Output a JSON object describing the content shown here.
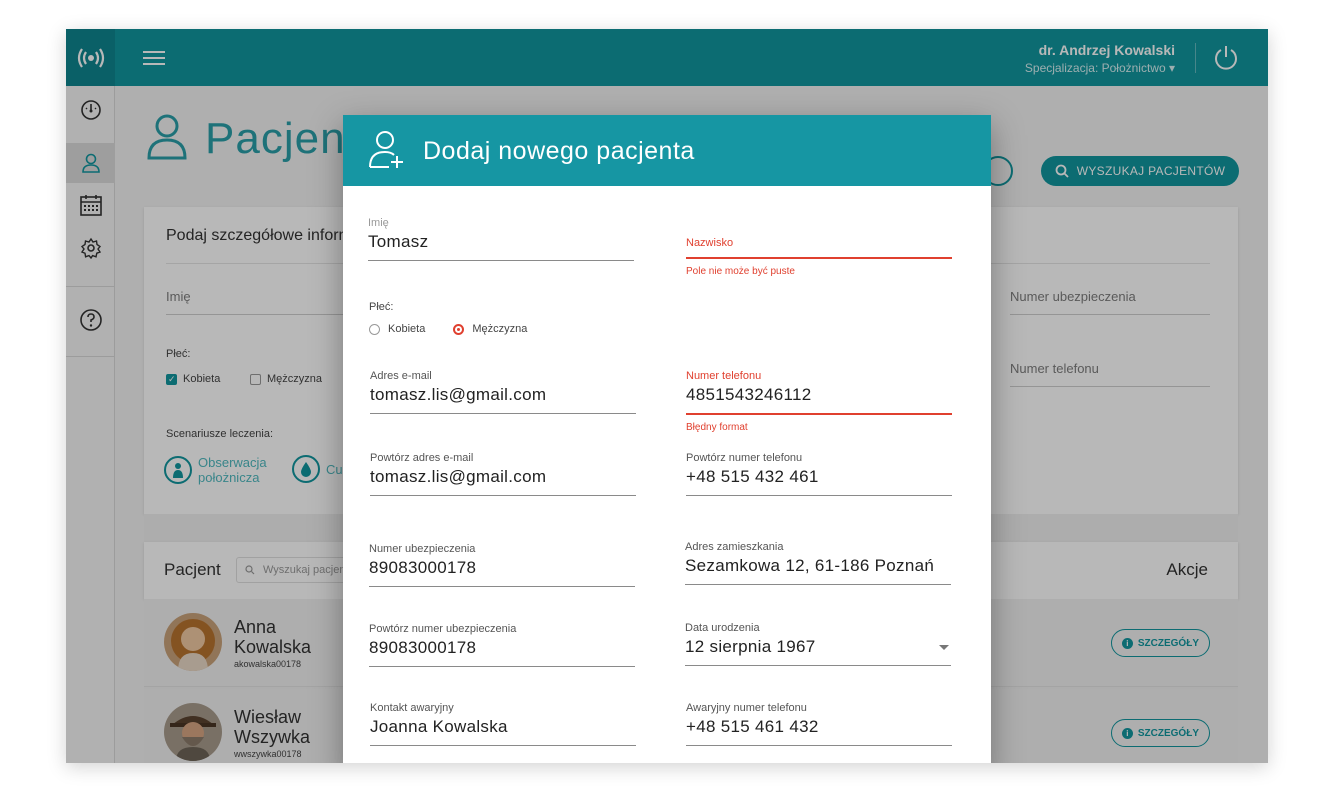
{
  "topbar": {
    "user_name": "dr. Andrzej Kowalski",
    "user_spec": "Specjalizacja: Położnictwo ▾"
  },
  "sidebar": {
    "items": [
      {
        "name": "dashboard-icon"
      },
      {
        "name": "user-icon"
      },
      {
        "name": "calendar-icon"
      },
      {
        "name": "gear-icon"
      },
      {
        "name": "help-icon"
      }
    ]
  },
  "page": {
    "title": "Pacjenci",
    "search_button": "WYSZUKAJ PACJENTÓW",
    "filters": {
      "title": "Podaj szczegółowe informacje",
      "first_name_placeholder": "Imię",
      "insurance_placeholder": "Numer ubezpieczenia",
      "phone_placeholder": "Numer telefonu",
      "gender_label": "Płeć:",
      "gender_female": "Kobieta",
      "gender_male": "Mężczyzna",
      "scenarios_label": "Scenariusze leczenia:",
      "scenario_1": "Obserwacja położnicza",
      "scenario_2": "Cu"
    },
    "list": {
      "col_patient": "Pacjent",
      "search_placeholder": "Wyszukaj pacjenta",
      "col_actions": "Akcje",
      "details_label": "SZCZEGÓŁY",
      "rows": [
        {
          "first": "Anna",
          "last": "Kowalska",
          "user": "akowalska00178"
        },
        {
          "first": "Wiesław",
          "last": "Wszywka",
          "user": "wwszywka00178"
        }
      ]
    }
  },
  "modal": {
    "title": "Dodaj nowego pacjenta",
    "first_name": {
      "label": "Imię",
      "value": "Tomasz"
    },
    "last_name": {
      "label": "Nazwisko",
      "value": "",
      "error": "Pole nie może być puste"
    },
    "gender": {
      "label": "Płeć:",
      "female": "Kobieta",
      "male": "Mężczyzna",
      "selected": "male"
    },
    "email": {
      "label": "Adres e-mail",
      "value": "tomasz.lis@gmail.com"
    },
    "phone": {
      "label": "Numer telefonu",
      "value": "4851543246112",
      "error": "Błędny format"
    },
    "email_repeat": {
      "label": "Powtórz adres e-mail",
      "value": "tomasz.lis@gmail.com"
    },
    "phone_repeat": {
      "label": "Powtórz numer telefonu",
      "value": "+48 515 432 461"
    },
    "insurance": {
      "label": "Numer ubezpieczenia",
      "value": "89083000178"
    },
    "address": {
      "label": "Adres zamieszkania",
      "value": "Sezamkowa 12, 61-186 Poznań"
    },
    "insurance_repeat": {
      "label": "Powtórz numer ubezpieczenia",
      "value": "89083000178"
    },
    "birth_date": {
      "label": "Data urodzenia",
      "value": "12 sierpnia 1967"
    },
    "emergency_contact": {
      "label": "Kontakt awaryjny",
      "value": "Joanna Kowalska"
    },
    "emergency_phone": {
      "label": "Awaryjny numer telefonu",
      "value": "+48 515 461 432"
    }
  },
  "colors": {
    "accent": "#11969f",
    "error": "#e0402f"
  }
}
